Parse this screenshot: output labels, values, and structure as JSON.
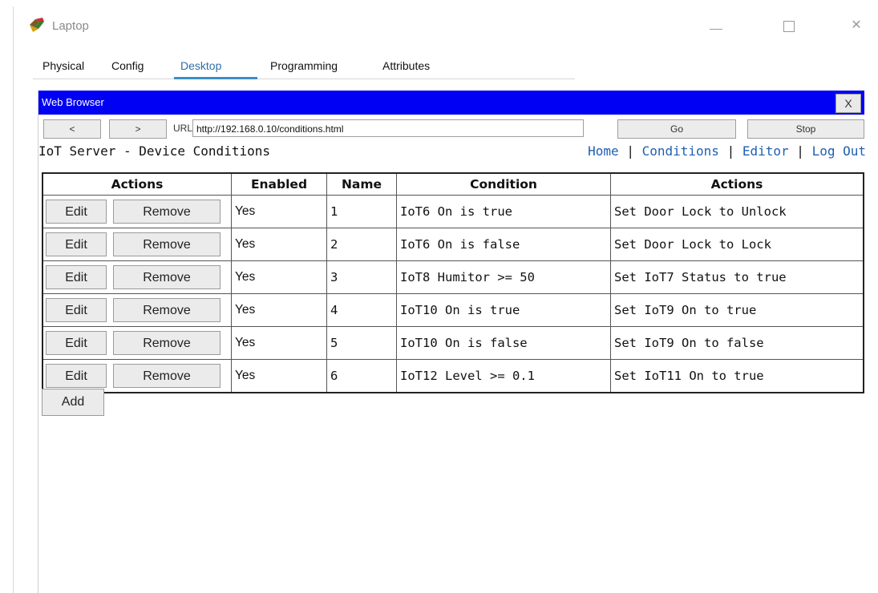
{
  "window": {
    "title": "Laptop",
    "minimize_label": "—",
    "maximize_label": "☐",
    "close_label": "✕"
  },
  "tabs": [
    {
      "label": "Physical",
      "active": false
    },
    {
      "label": "Config",
      "active": false
    },
    {
      "label": "Desktop",
      "active": true
    },
    {
      "label": "Programming",
      "active": false
    },
    {
      "label": "Attributes",
      "active": false
    }
  ],
  "browser": {
    "title": "Web Browser",
    "close_label": "X",
    "back_label": "<",
    "forward_label": ">",
    "url_label": "URL",
    "url": "http://192.168.0.10/conditions.html",
    "go_label": "Go",
    "stop_label": "Stop"
  },
  "page": {
    "heading": "IoT Server - Device Conditions",
    "links": {
      "home": "Home",
      "conditions": "Conditions",
      "editor": "Editor",
      "logout": "Log Out",
      "separator": "|"
    },
    "table": {
      "headers": [
        "Actions",
        "Enabled",
        "Name",
        "Condition",
        "Actions"
      ],
      "edit_label": "Edit",
      "remove_label": "Remove",
      "rows": [
        {
          "enabled": "Yes",
          "name": "1",
          "condition": "IoT6 On is true",
          "action": "Set Door Lock to Unlock"
        },
        {
          "enabled": "Yes",
          "name": "2",
          "condition": "IoT6 On is false",
          "action": "Set Door Lock to Lock"
        },
        {
          "enabled": "Yes",
          "name": "3",
          "condition": "IoT8 Humitor >= 50",
          "action": "Set IoT7 Status to true"
        },
        {
          "enabled": "Yes",
          "name": "4",
          "condition": "IoT10 On is true",
          "action": "Set IoT9 On to true"
        },
        {
          "enabled": "Yes",
          "name": "5",
          "condition": "IoT10 On is false",
          "action": "Set IoT9 On to false"
        },
        {
          "enabled": "Yes",
          "name": "6",
          "condition": "IoT12 Level >= 0.1",
          "action": "Set IoT11 On to true"
        }
      ]
    },
    "add_label": "Add"
  },
  "colors": {
    "browser_titlebar": "#0000f5",
    "active_tab_underline": "#3a8dc9",
    "link": "#1f5fb3"
  }
}
